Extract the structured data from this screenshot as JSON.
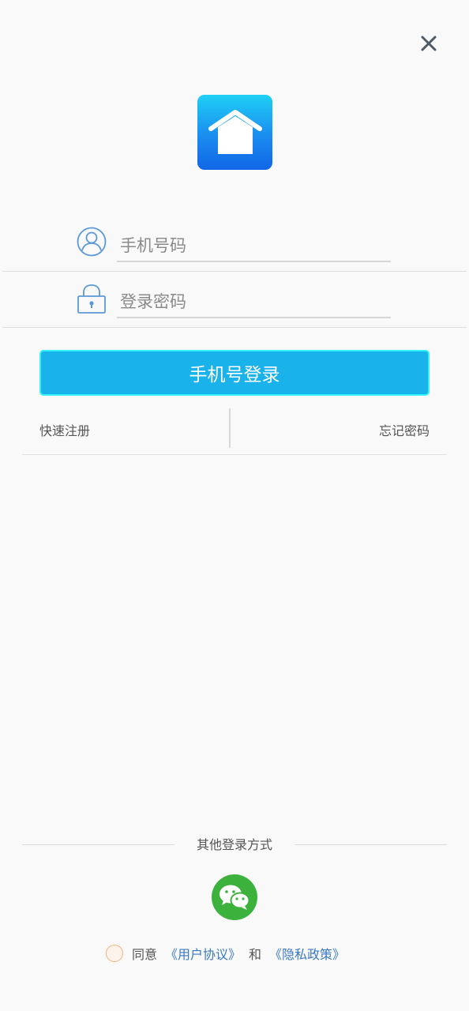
{
  "header": {
    "close_icon": "close-icon"
  },
  "logo": {
    "icon": "house-icon",
    "color_top": "#1fd0f5",
    "color_bottom": "#1166e6"
  },
  "form": {
    "phone": {
      "placeholder": "手机号码",
      "value": "",
      "icon": "user-icon"
    },
    "password": {
      "placeholder": "登录密码",
      "value": "",
      "icon": "lock-icon"
    },
    "login_button_label": "手机号登录",
    "accent_color": "#19b2eb"
  },
  "links": {
    "register": "快速注册",
    "forgot_password": "忘记密码"
  },
  "other_login": {
    "label": "其他登录方式",
    "wechat_icon": "wechat-icon",
    "wechat_color": "#3cb23c"
  },
  "agreement": {
    "prefix": "同意",
    "user_agreement": "《用户协议》",
    "and": "和",
    "privacy_policy": "《隐私政策》",
    "checked": false
  }
}
